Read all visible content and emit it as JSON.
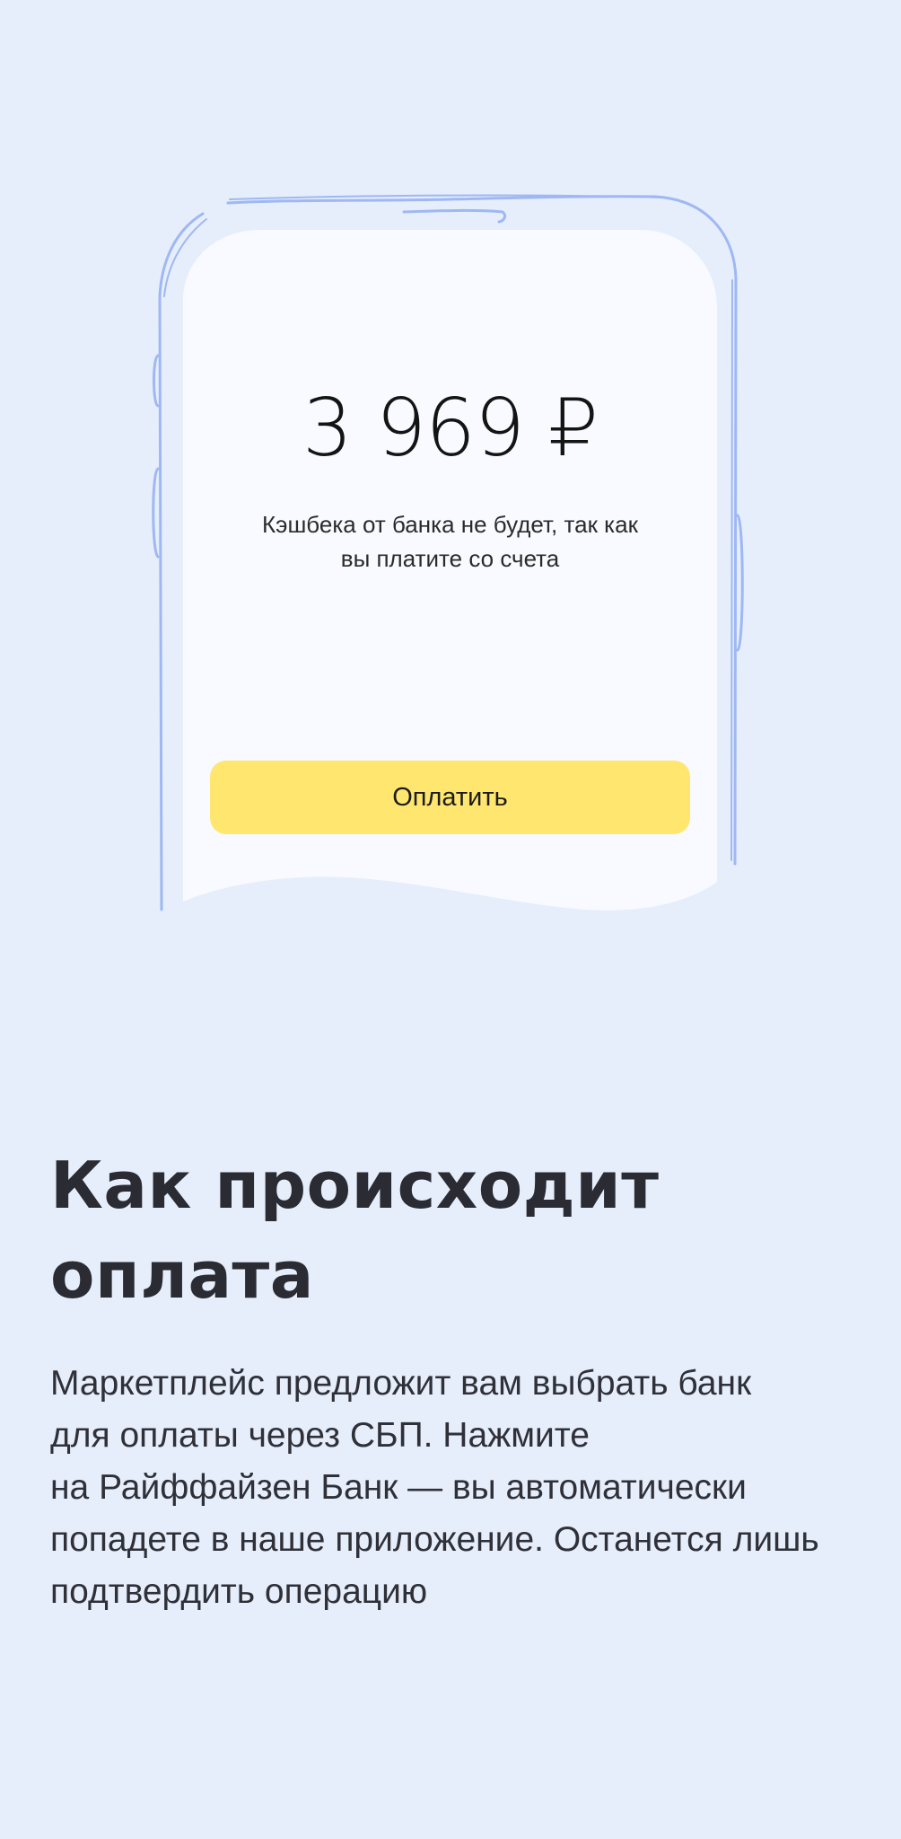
{
  "phone_screen": {
    "amount": "3 969 ₽",
    "cashback_note_lines": [
      "Кэшбека от банка не будет, так как",
      "вы платите со счета"
    ],
    "pay_button_label": "Оплатить"
  },
  "section": {
    "title": "Как происходит оплата",
    "description_lines": [
      "Маркетплейс предложит вам выбрать банк",
      "для оплаты через СБП. Нажмите",
      "на Райффайзен Банк — вы автоматически",
      "попадете в наше приложение. Останется лишь",
      "подтвердить операцию"
    ]
  },
  "colors": {
    "background": "#e6eefb",
    "phone_outline": "#9fb8f3",
    "screen": "#f8faff",
    "pay_button": "#ffe66f",
    "heading_text": "#2a2b33"
  }
}
